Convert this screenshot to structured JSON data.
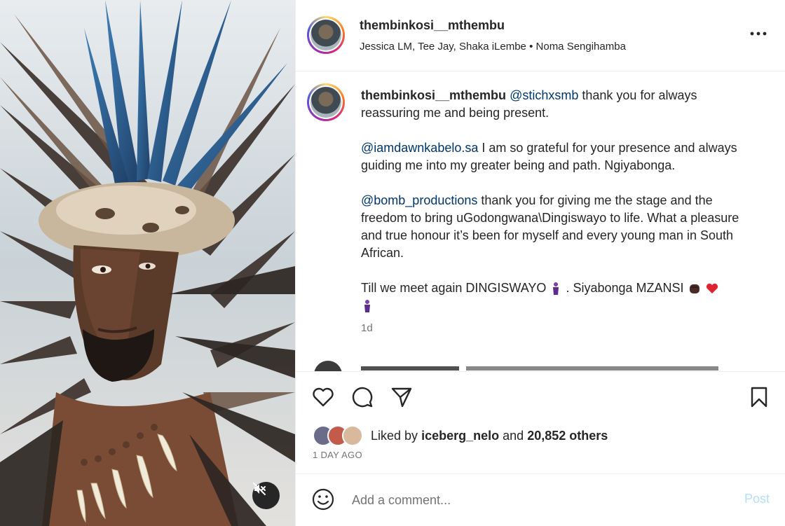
{
  "post": {
    "author": "thembinkosi__mthembu",
    "collaborators_line": "Jessica LM, Tee Jay, Shaka iLembe",
    "separator": "•",
    "audio": "Noma Sengihamba"
  },
  "caption": {
    "author": "thembinkosi__mthembu",
    "p1_mention": "@stichxsmb",
    "p1_text": "thank you for always reassuring me and being present.",
    "p2_mention": "@iamdawnkabelo.sa",
    "p2_text": "I am so grateful for your presence and always guiding me into my greater being and path. Ngiyabonga.",
    "p3_mention": "@bomb_productions",
    "p3_text": "thank you for giving me the stage and the freedom to bring uGodongwana\\Dingiswayo to life. What a pleasure and true honour it’s been for myself and every young man in South African.",
    "p4_a": "Till we meet again DINGISWAYO",
    "p4_b": ". Siyabonga MZANSI",
    "emoji_a": "person-standing-icon",
    "emoji_b": "raised-fist-icon",
    "emoji_c": "red-heart-icon",
    "time_ago": "1d"
  },
  "actions": {
    "like_icon": "heart-icon",
    "comment_icon": "comment-icon",
    "share_icon": "send-icon",
    "save_icon": "bookmark-icon"
  },
  "likes": {
    "prefix": "Liked by",
    "user": "iceberg_nelo",
    "middle": "and",
    "others": "20,852 others"
  },
  "date": "1 DAY AGO",
  "comment_box": {
    "placeholder": "Add a comment...",
    "post_label": "Post"
  },
  "colors": {
    "mention": "#00376b",
    "post_disabled": "#b2dffc",
    "muted": "#737373"
  }
}
